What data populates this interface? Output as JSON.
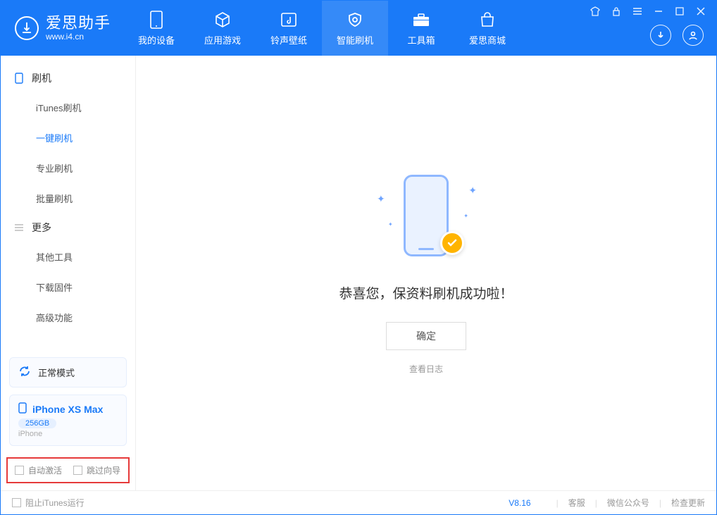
{
  "app": {
    "name_cn": "爱思助手",
    "name_en": "www.i4.cn"
  },
  "nav": {
    "items": [
      {
        "label": "我的设备"
      },
      {
        "label": "应用游戏"
      },
      {
        "label": "铃声壁纸"
      },
      {
        "label": "智能刷机"
      },
      {
        "label": "工具箱"
      },
      {
        "label": "爱思商城"
      }
    ],
    "active_index": 3
  },
  "sidebar": {
    "sections": [
      {
        "title": "刷机",
        "items": [
          "iTunes刷机",
          "一键刷机",
          "专业刷机",
          "批量刷机"
        ],
        "active_index": 1
      },
      {
        "title": "更多",
        "items": [
          "其他工具",
          "下载固件",
          "高级功能"
        ]
      }
    ],
    "mode": "正常模式",
    "device": {
      "name": "iPhone XS Max",
      "storage": "256GB",
      "type": "iPhone"
    },
    "checkboxes": {
      "auto_activate": "自动激活",
      "skip_guide": "跳过向导"
    }
  },
  "main": {
    "success_msg": "恭喜您，保资料刷机成功啦！",
    "ok_btn": "确定",
    "log_link": "查看日志"
  },
  "footer": {
    "stop_itunes": "阻止iTunes运行",
    "version": "V8.16",
    "links": [
      "客服",
      "微信公众号",
      "检查更新"
    ]
  }
}
